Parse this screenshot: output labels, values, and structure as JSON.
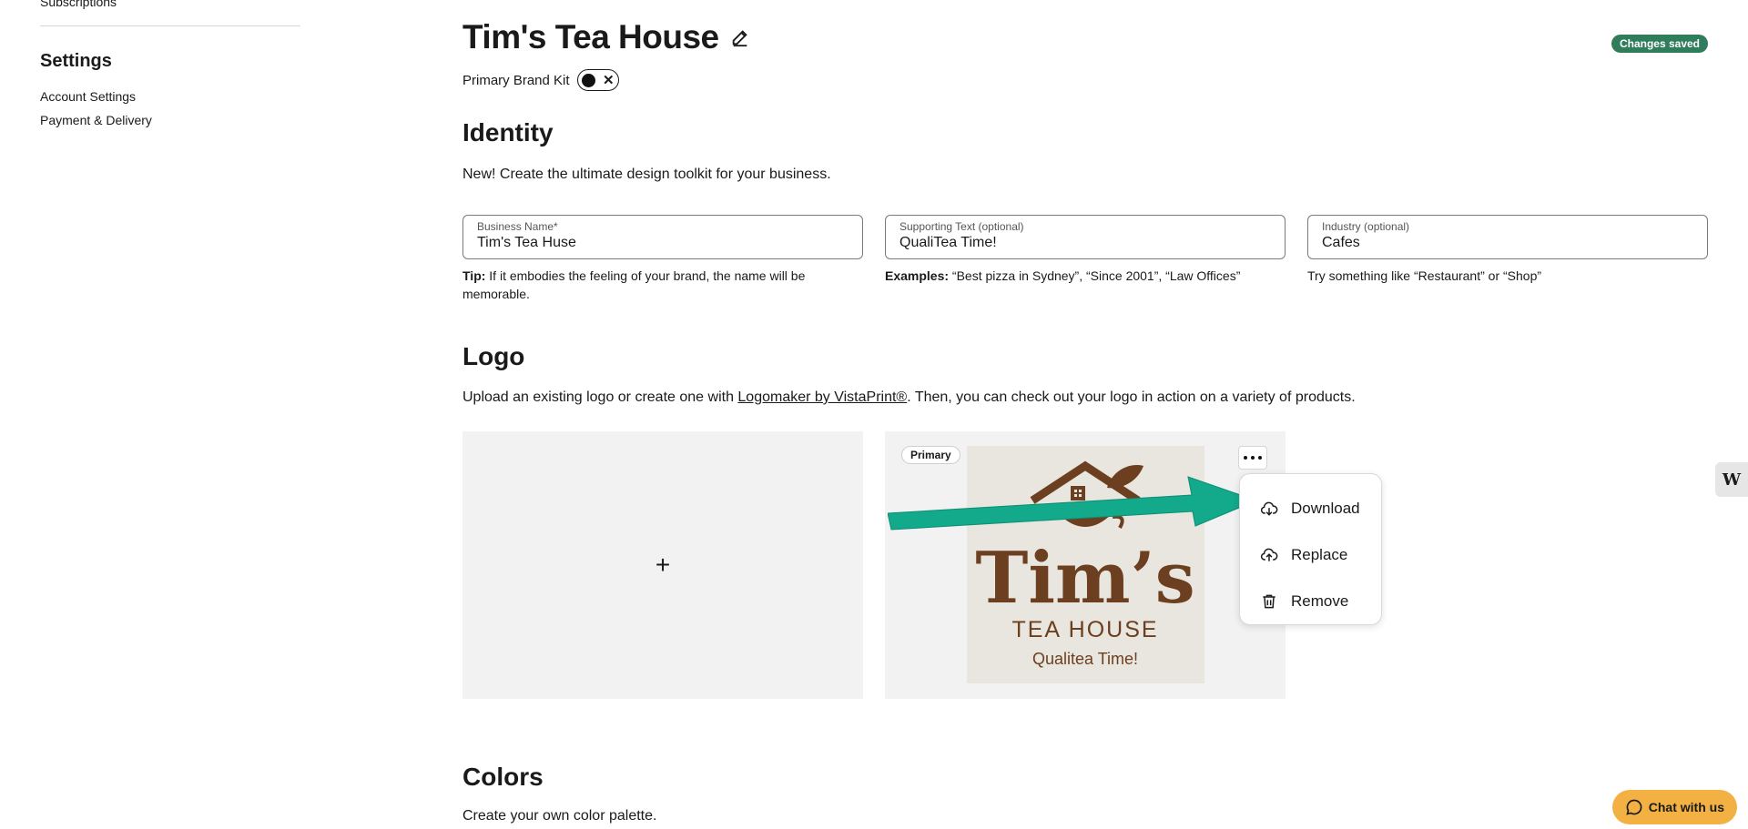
{
  "sidebar": {
    "subscriptions": "Subscriptions",
    "settings_title": "Settings",
    "items": [
      {
        "label": "Account Settings"
      },
      {
        "label": "Payment & Delivery"
      }
    ]
  },
  "header": {
    "title": "Tim's Tea House",
    "saved_badge": "Changes saved",
    "brand_kit_label": "Primary Brand Kit"
  },
  "identity": {
    "heading": "Identity",
    "description": "New! Create the ultimate design toolkit for your business.",
    "fields": [
      {
        "label": "Business Name*",
        "value": "Tim's Tea Huse",
        "help_bold": "Tip:",
        "help_text": " If it embodies the feeling of your brand, the name will be memorable."
      },
      {
        "label": "Supporting Text (optional)",
        "value": "QualiTea Time!",
        "help_bold": "Examples:",
        "help_text": " “Best pizza in Sydney”, “Since 2001”, “Law Offices”"
      },
      {
        "label": "Industry (optional)",
        "value": "Cafes",
        "help_bold": "",
        "help_text": "Try something like “Restaurant” or “Shop”"
      }
    ]
  },
  "logo": {
    "heading": "Logo",
    "description_pre": "Upload an existing logo or create one with ",
    "description_link": "Logomaker by VistaPrint®",
    "description_post": ". Then, you can check out your logo in action on a variety of products.",
    "add_symbol": "+",
    "primary_badge": "Primary",
    "logo_text_main": "Tim’s",
    "logo_text_sub": "TEA HOUSE",
    "logo_text_tag": "Qualitea Time!",
    "menu": [
      {
        "label": "Download",
        "icon": "cloud-download-icon"
      },
      {
        "label": "Replace",
        "icon": "cloud-upload-icon"
      },
      {
        "label": "Remove",
        "icon": "trash-icon"
      }
    ]
  },
  "colors": {
    "heading": "Colors",
    "description": "Create your own color palette."
  },
  "widgets": {
    "side_letter": "W",
    "chat_label": "Chat with us"
  },
  "palette": {
    "accent_green": "#2f7d5a",
    "arrow_teal": "#13a98b",
    "logo_brown": "#6b3f1f",
    "chat_orange": "#f3b144"
  }
}
